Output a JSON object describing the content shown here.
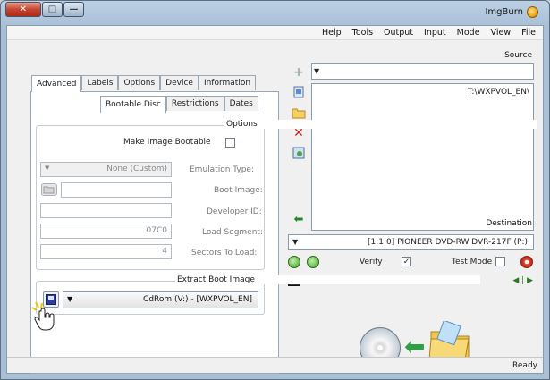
{
  "window": {
    "title": "ImgBurn",
    "close_glyph": "✕",
    "max_glyph": "□",
    "min_glyph": "—"
  },
  "menu": [
    "File",
    "View",
    "Mode",
    "Input",
    "Output",
    "Tools",
    "Help"
  ],
  "source": {
    "label": "Source",
    "combo_value": "",
    "entry": "T:\\WXPVOL_EN\\"
  },
  "destination": {
    "label": "Destination",
    "drive": "[1:1:0] PIONEER DVD-RW  DVR-217F (P:)",
    "verify_label": "Verify",
    "verify_checked": true,
    "test_mode_label": "Test Mode",
    "test_mode_checked": false
  },
  "tabs_row1": [
    "Information",
    "Device",
    "Options",
    "Labels",
    "Advanced"
  ],
  "tabs_row1_active": "Advanced",
  "tabs_row2": [
    "Dates",
    "Restrictions",
    "Bootable Disc"
  ],
  "tabs_row2_active": "Bootable Disc",
  "options": {
    "legend": "Options",
    "make_bootable_label": "Make Image Bootable",
    "make_bootable_checked": false,
    "emulation_label": "Emulation Type:",
    "emulation_value": "None (Custom)",
    "boot_image_label": "Boot Image:",
    "boot_image_value": "",
    "developer_id_label": "Developer ID:",
    "developer_id_value": "",
    "load_segment_label": "Load Segment:",
    "load_segment_value": "07C0",
    "sectors_label": "Sectors To Load:",
    "sectors_value": "4"
  },
  "extract": {
    "legend": "Extract Boot Image",
    "device_value": "CdRom (V:) - [WXPVOL_EN]"
  },
  "status": "Ready",
  "colors": {
    "accent_green": "#2da043",
    "delete_red": "#c8231b"
  },
  "icons": {
    "add": "+",
    "delete": "✕",
    "go": "⬅",
    "dropdown": "▼",
    "media_nav": "◀ | ▶",
    "check": "✓"
  }
}
